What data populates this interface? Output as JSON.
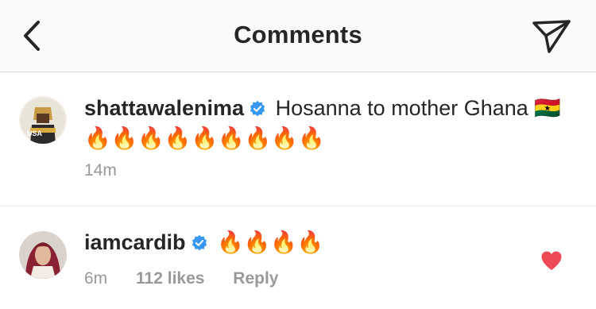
{
  "header": {
    "title": "Comments",
    "back_icon": "chevron-left-icon",
    "share_icon": "paper-plane-icon"
  },
  "comments": [
    {
      "username": "shattawalenima",
      "verified": true,
      "text": "Hosanna to mother Ghana 🇬🇭 🔥🔥🔥🔥🔥🔥🔥🔥🔥",
      "time": "14m"
    },
    {
      "username": "iamcardib",
      "verified": true,
      "text": "🔥🔥🔥🔥",
      "time": "6m",
      "likes": "112 likes",
      "reply_label": "Reply",
      "liked": true
    }
  ],
  "colors": {
    "verified_blue": "#3897f0",
    "like_red": "#ed4956",
    "meta_gray": "#999999"
  }
}
